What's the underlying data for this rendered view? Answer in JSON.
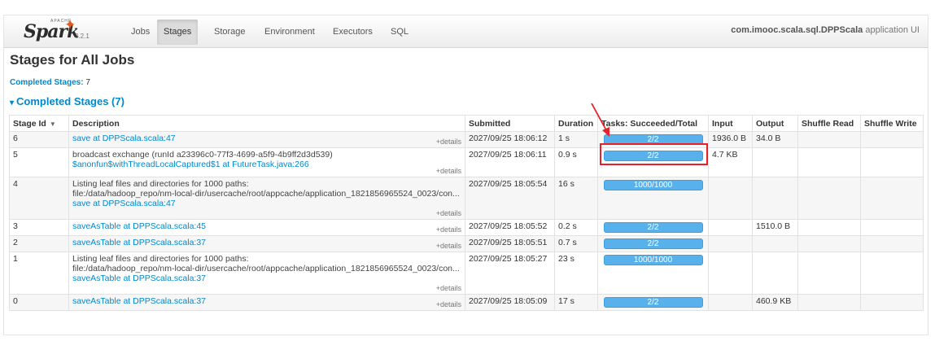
{
  "nav": {
    "brand_apache": "APACHE",
    "brand_name": "Spark",
    "version": "3.2.1",
    "items": [
      {
        "label": "Jobs",
        "active": false
      },
      {
        "label": "Stages",
        "active": true
      },
      {
        "label": "Storage",
        "active": false
      },
      {
        "label": "Environment",
        "active": false
      },
      {
        "label": "Executors",
        "active": false
      },
      {
        "label": "SQL",
        "active": false
      }
    ],
    "app_name": "com.imooc.scala.sql.DPPScala",
    "app_suffix": " application UI"
  },
  "page_title": "Stages for All Jobs",
  "completed_label": "Completed Stages:",
  "completed_count": " 7",
  "section_title": "Completed Stages (7)",
  "table": {
    "headers": [
      "Stage Id",
      "Description",
      "Submitted",
      "Duration",
      "Tasks: Succeeded/Total",
      "Input",
      "Output",
      "Shuffle Read",
      "Shuffle Write"
    ],
    "details_label": "+details",
    "rows": [
      {
        "stage_id": "6",
        "lines": [],
        "link": "save at DPPScala.scala:47",
        "submitted": "2027/09/25 18:06:12",
        "duration": "1 s",
        "tasks": "2/2",
        "tasks_fraction": 1.0,
        "input": "1936.0 B",
        "output": "34.0 B",
        "shuffle_read": "",
        "shuffle_write": ""
      },
      {
        "stage_id": "5",
        "lines": [
          "broadcast exchange (runId a23396c0-77f3-4699-a5f9-4b9ff2d3d539)"
        ],
        "link": "$anonfun$withThreadLocalCaptured$1 at FutureTask.java:266",
        "submitted": "2027/09/25 18:06:11",
        "duration": "0.9 s",
        "tasks": "2/2",
        "tasks_fraction": 1.0,
        "input": "4.7 KB",
        "output": "",
        "shuffle_read": "",
        "shuffle_write": ""
      },
      {
        "stage_id": "4",
        "lines": [
          "Listing leaf files and directories for 1000 paths:",
          "file:/data/hadoop_repo/nm-local-dir/usercache/root/appcache/application_1821856965524_0023/con..."
        ],
        "link": "save at DPPScala.scala:47",
        "submitted": "2027/09/25 18:05:54",
        "duration": "16 s",
        "tasks": "1000/1000",
        "tasks_fraction": 1.0,
        "input": "",
        "output": "",
        "shuffle_read": "",
        "shuffle_write": ""
      },
      {
        "stage_id": "3",
        "lines": [],
        "link": "saveAsTable at DPPScala.scala:45",
        "submitted": "2027/09/25 18:05:52",
        "duration": "0.2 s",
        "tasks": "2/2",
        "tasks_fraction": 1.0,
        "input": "",
        "output": "1510.0 B",
        "shuffle_read": "",
        "shuffle_write": ""
      },
      {
        "stage_id": "2",
        "lines": [],
        "link": "saveAsTable at DPPScala.scala:37",
        "submitted": "2027/09/25 18:05:51",
        "duration": "0.7 s",
        "tasks": "2/2",
        "tasks_fraction": 1.0,
        "input": "",
        "output": "",
        "shuffle_read": "",
        "shuffle_write": ""
      },
      {
        "stage_id": "1",
        "lines": [
          "Listing leaf files and directories for 1000 paths:",
          "file:/data/hadoop_repo/nm-local-dir/usercache/root/appcache/application_1821856965524_0023/con..."
        ],
        "link": "saveAsTable at DPPScala.scala:37",
        "submitted": "2027/09/25 18:05:27",
        "duration": "23 s",
        "tasks": "1000/1000",
        "tasks_fraction": 1.0,
        "input": "",
        "output": "",
        "shuffle_read": "",
        "shuffle_write": ""
      },
      {
        "stage_id": "0",
        "lines": [],
        "link": "saveAsTable at DPPScala.scala:37",
        "submitted": "2027/09/25 18:05:09",
        "duration": "17 s",
        "tasks": "2/2",
        "tasks_fraction": 1.0,
        "input": "",
        "output": "460.9 KB",
        "shuffle_read": "",
        "shuffle_write": ""
      }
    ]
  },
  "colors": {
    "link": "#0088cc",
    "progress_fill": "#59b1ec",
    "annotation": "#e8202a"
  }
}
